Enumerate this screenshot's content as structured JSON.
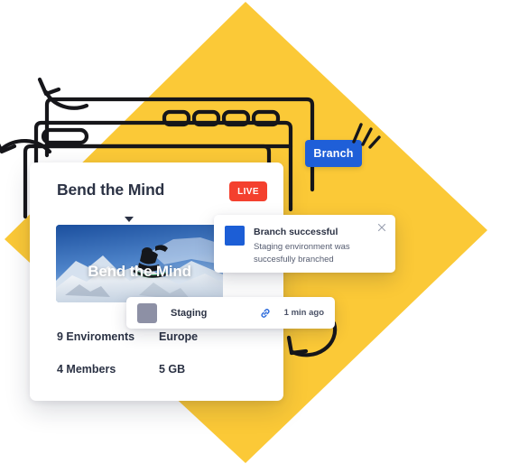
{
  "theme": {
    "accent_yellow": "#fbc937",
    "accent_blue": "#1f5fd8",
    "badge_red": "#f4402e",
    "toast_blue": "#1c5ed6",
    "swatch_gray": "#8d90a5",
    "text_dark": "#2b3244",
    "card_bg": "#ffffff",
    "page_bg": "#ffffff",
    "line_art": "#16161a"
  },
  "branch_button": {
    "label": "Branch"
  },
  "card": {
    "title": "Bend the Mind",
    "status_badge": "LIVE",
    "expand_caret_icon": "chevron-down-icon",
    "photo": {
      "overlay_label": "Bend the Mind",
      "alt": "snowboarder jumping on snowy mountain under blue sky"
    },
    "stats": [
      {
        "left": "9 Enviroments",
        "right": "Europe"
      },
      {
        "left": "4 Members",
        "right": "5 GB"
      }
    ]
  },
  "staging_row": {
    "swatch_icon": "color-swatch-icon",
    "name": "Staging",
    "link_icon": "link-icon",
    "timestamp": "1 min ago"
  },
  "toast": {
    "swatch_icon": "color-swatch-icon",
    "title": "Branch successful",
    "body": "Staging environment was succesfully branched",
    "close_icon": "close-icon"
  },
  "decor": {
    "wireframe_icon": "browser-windows-wireframe-icon",
    "nav_pill_count": 4,
    "arrow_top_left_icon": "curved-arrow-down-left-icon",
    "arrow_top_mid_icon": "curved-arrow-down-left-icon",
    "arrow_bottom_icon": "curved-arrow-up-left-icon",
    "sparkles_icon": "sparkle-lines-icon",
    "diamond_icon": "yellow-diamond-shape"
  }
}
